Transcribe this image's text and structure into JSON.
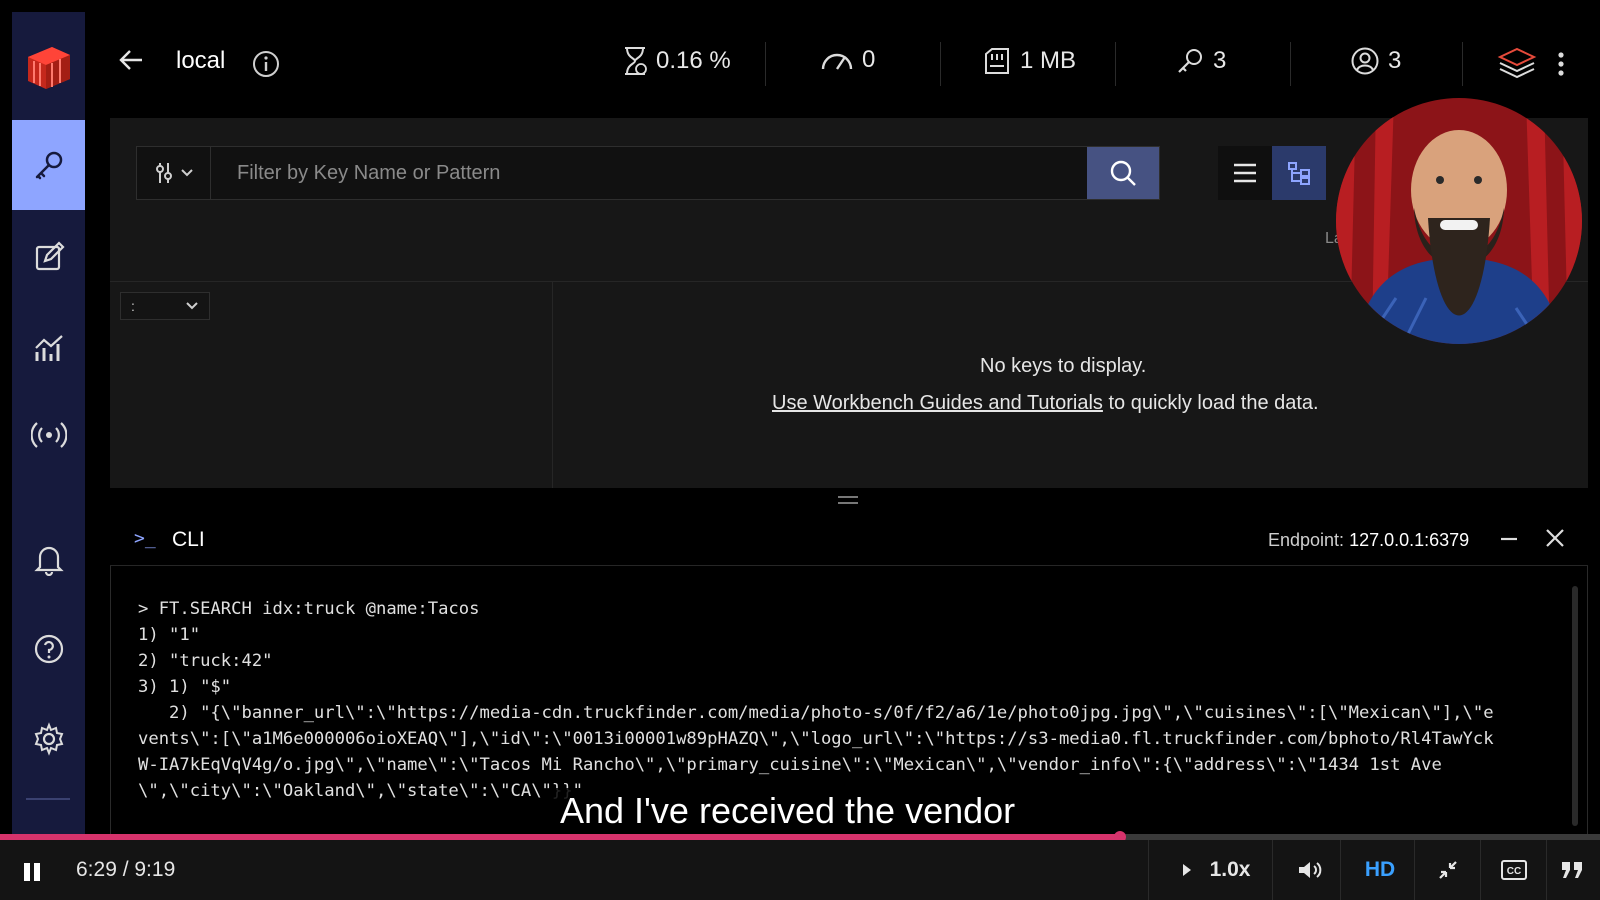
{
  "topbar": {
    "db_name": "local",
    "stats": {
      "cpu": "0.16 %",
      "ops": "0",
      "memory": "1 MB",
      "keys": "3",
      "clients": "3"
    }
  },
  "browser": {
    "filter_placeholder": "Filter by Key Name or Pattern",
    "delimiter": ":",
    "label_cut": "La",
    "empty_title": "No keys to display.",
    "empty_link": "Use Workbench Guides and Tutorials",
    "empty_suffix": " to quickly load the data."
  },
  "cli": {
    "title": "CLI",
    "endpoint_label": "Endpoint:",
    "endpoint_value": "127.0.0.1:6379",
    "lines": [
      "> FT.SEARCH idx:truck @name:Tacos",
      "1) \"1\"",
      "2) \"truck:42\"",
      "3) 1) \"$\"",
      "   2) \"{\\\"banner_url\\\":\\\"https://media-cdn.truckfinder.com/media/photo-s/0f/f2/a6/1e/photo0jpg.jpg\\\",\\\"cuisines\\\":[\\\"Mexican\\\"],\\\"e",
      "vents\\\":[\\\"a1M6e000006oioXEAQ\\\"],\\\"id\\\":\\\"0013i00001w89pHAZQ\\\",\\\"logo_url\\\":\\\"https://s3-media0.fl.truckfinder.com/bphoto/Rl4TawYck",
      "W-IA7kEqVqV4g/o.jpg\\\",\\\"name\\\":\\\"Tacos Mi Rancho\\\",\\\"primary_cuisine\\\":\\\"Mexican\\\",\\\"vendor_info\\\":{\\\"address\\\":\\\"1434 1st Ave",
      "\\\",\\\"city\\\":\\\"Oakland\\\",\\\"state\\\":\\\"CA\\\"}}\""
    ]
  },
  "caption": "And I've received the vendor",
  "player": {
    "time": "6:29 / 9:19",
    "progress": 0.7,
    "speed": "1.0x",
    "quality": "HD",
    "cc": "CC"
  },
  "colors": {
    "sidebar": "#161a3d",
    "active": "#8ea5ff",
    "search_button": "#465282",
    "progress": "#d6336c",
    "hd": "#3aa0ff"
  }
}
